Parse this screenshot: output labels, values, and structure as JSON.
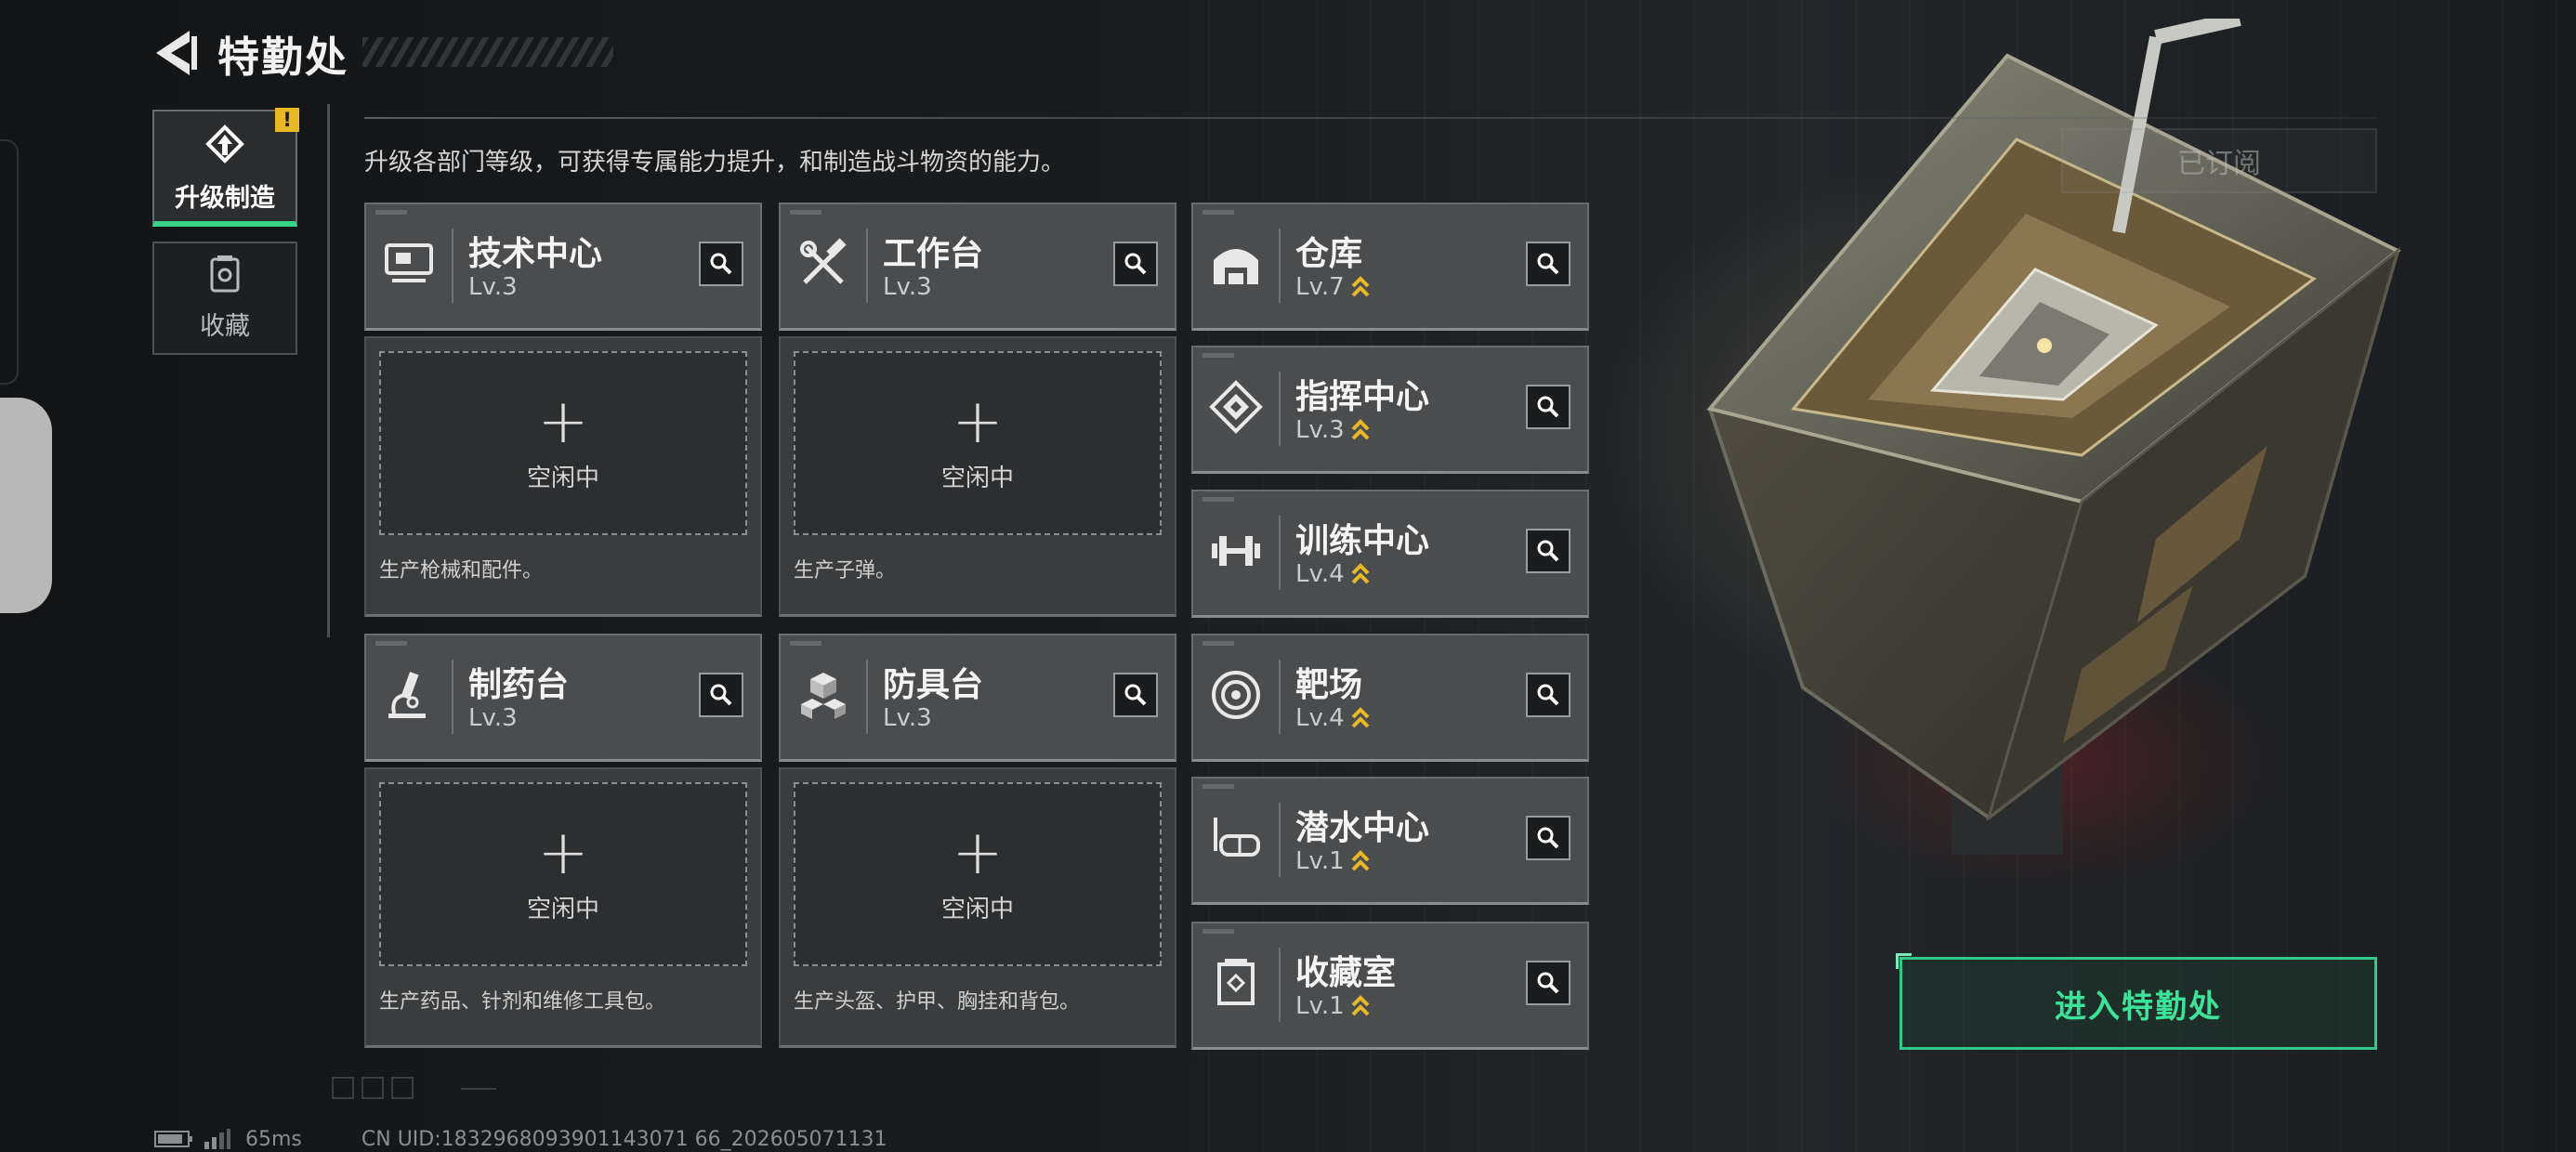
{
  "header": {
    "title": "特勤处",
    "back_icon": "back-arrow-icon"
  },
  "sidebar": {
    "tabs": [
      {
        "label": "升级制造",
        "icon": "upgrade-gear-icon",
        "active": true,
        "alert": "!"
      },
      {
        "label": "收藏",
        "icon": "collection-case-icon",
        "active": false
      }
    ]
  },
  "description": "升级各部门等级，可获得专属能力提升，和制造战斗物资的能力。",
  "production": [
    {
      "name": "技术中心",
      "level": "Lv.3",
      "icon": "tech-center-icon",
      "slot": "空闲中",
      "desc": "生产枪械和配件。"
    },
    {
      "name": "工作台",
      "level": "Lv.3",
      "icon": "workbench-tools-icon",
      "slot": "空闲中",
      "desc": "生产子弹。"
    },
    {
      "name": "制药台",
      "level": "Lv.3",
      "icon": "pharmacy-microscope-icon",
      "slot": "空闲中",
      "desc": "生产药品、针剂和维修工具包。"
    },
    {
      "name": "防具台",
      "level": "Lv.3",
      "icon": "armor-blocks-icon",
      "slot": "空闲中",
      "desc": "生产头盔、护甲、胸挂和背包。"
    }
  ],
  "departments": [
    {
      "name": "仓库",
      "level": "Lv.7",
      "icon": "warehouse-icon",
      "upgradable": true
    },
    {
      "name": "指挥中心",
      "level": "Lv.3",
      "icon": "command-center-icon",
      "upgradable": true
    },
    {
      "name": "训练中心",
      "level": "Lv.4",
      "icon": "dumbbell-icon",
      "upgradable": true
    },
    {
      "name": "靶场",
      "level": "Lv.4",
      "icon": "target-range-icon",
      "upgradable": true
    },
    {
      "name": "潜水中心",
      "level": "Lv.1",
      "icon": "diving-mask-icon",
      "upgradable": true
    },
    {
      "name": "收藏室",
      "level": "Lv.1",
      "icon": "collection-room-icon",
      "upgradable": true
    }
  ],
  "right_panel": {
    "subscribed_label": "已订阅",
    "enter_label": "进入特勤处"
  },
  "footer": {
    "latency": "65ms",
    "uid": "CN UID:1832968093901143071 66_202605071131"
  },
  "colors": {
    "accent_green": "#38d28b",
    "upgrade_gold": "#e8b829",
    "card_bg": "#4a4c4e"
  }
}
